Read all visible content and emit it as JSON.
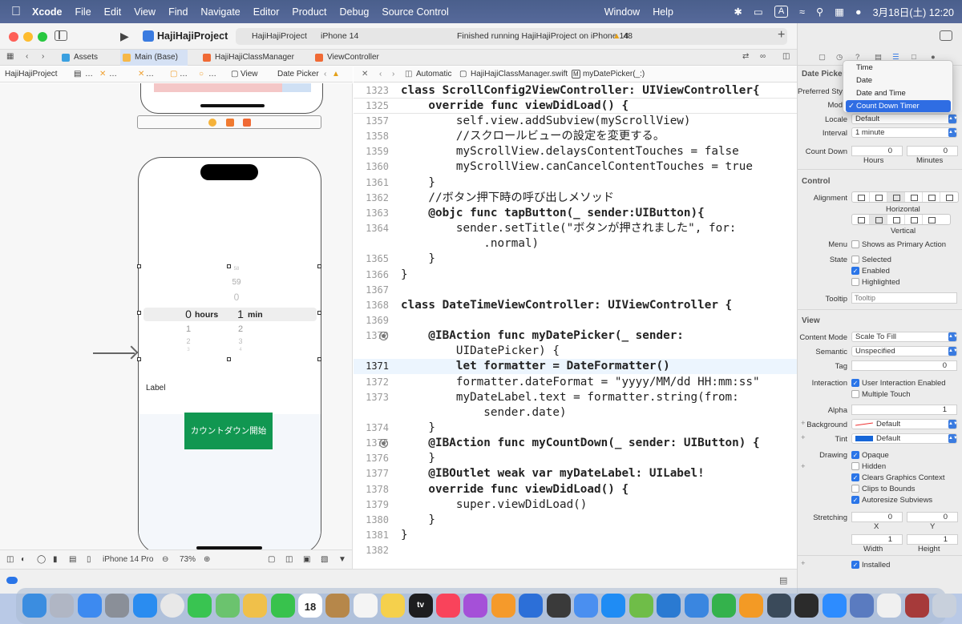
{
  "menubar": {
    "app_name": "Xcode",
    "items": [
      "File",
      "Edit",
      "View",
      "Find",
      "Navigate",
      "Editor",
      "Product",
      "Debug",
      "Source Control",
      "Window",
      "Help"
    ],
    "input_mode": "A",
    "datetime": "3月18日(土) 12:20"
  },
  "toolbar": {
    "project_name": "HajiHajiProject",
    "scheme": "HajiHajiProject",
    "destination": "iPhone 14",
    "status": "Finished running HajiHajiProject on iPhone 14",
    "warnings": "48"
  },
  "tabs": [
    {
      "label": "Assets",
      "icon": "assets-icon"
    },
    {
      "label": "Main (Base)",
      "icon": "storyboard-icon"
    },
    {
      "label": "HajiHajiClassManager",
      "icon": "swift-file-icon"
    },
    {
      "label": "ViewController",
      "icon": "swift-file-icon"
    }
  ],
  "left_jumpbar": [
    "HajiHajiProject",
    "…",
    "…",
    "…",
    "…",
    "View",
    "Date Picker"
  ],
  "right_jumpbar": [
    "Automatic",
    "HajiHajiClassManager.swift",
    "myDatePicker(_:)"
  ],
  "canvas": {
    "picker": {
      "above_small": "58",
      "above1": "59",
      "above2": "0",
      "hours_value": "0",
      "hours_label": "hours",
      "min_value": "1",
      "min_label": "min",
      "below_h1": "1",
      "below_h2": "2",
      "below_h3": "3",
      "below_m1": "2",
      "below_m2": "3",
      "below_m3": "4"
    },
    "label_text": "Label",
    "button_text": "カウントダウン開始"
  },
  "canvas_bottom": {
    "device": "iPhone 14 Pro",
    "zoom": "73%"
  },
  "code": {
    "sticky": [
      {
        "n": "1323",
        "t": "class ScrollConfig2ViewController: UIViewController{"
      },
      {
        "n": "1325",
        "t": "    override func viewDidLoad() {"
      }
    ],
    "lines": [
      {
        "n": "1357",
        "t": "        self.view.addSubview(myScrollView)"
      },
      {
        "n": "1358",
        "t": "        //スクロールビューの設定を変更する。"
      },
      {
        "n": "1359",
        "t": "        myScrollView.delaysContentTouches = false"
      },
      {
        "n": "1360",
        "t": "        myScrollView.canCancelContentTouches = true"
      },
      {
        "n": "1361",
        "t": "    }"
      },
      {
        "n": "1362",
        "t": "    //ボタン押下時の呼び出しメソッド"
      },
      {
        "n": "1363",
        "t": "    @objc func tapButton(_ sender:UIButton){"
      },
      {
        "n": "1364",
        "t": "        sender.setTitle(\"ボタンが押されました\", for:"
      },
      {
        "n": "",
        "t": "            .normal)"
      },
      {
        "n": "1365",
        "t": "    }"
      },
      {
        "n": "1366",
        "t": "}"
      },
      {
        "n": "1367",
        "t": ""
      },
      {
        "n": "1368",
        "t": "class DateTimeViewController: UIViewController {"
      },
      {
        "n": "1369",
        "t": ""
      },
      {
        "n": "1370",
        "t": "    @IBAction func myDatePicker(_ sender:"
      },
      {
        "n": "",
        "t": "        UIDatePicker) {"
      },
      {
        "n": "1371",
        "t": "        let formatter = DateFormatter()"
      },
      {
        "n": "1372",
        "t": "        formatter.dateFormat = \"yyyy/MM/dd HH:mm:ss\""
      },
      {
        "n": "1373",
        "t": "        myDateLabel.text = formatter.string(from:"
      },
      {
        "n": "",
        "t": "            sender.date)"
      },
      {
        "n": "1374",
        "t": "    }"
      },
      {
        "n": "1375",
        "t": "    @IBAction func myCountDown(_ sender: UIButton) {"
      },
      {
        "n": "1376",
        "t": "    }"
      },
      {
        "n": "1377",
        "t": "    @IBOutlet weak var myDateLabel: UILabel!"
      },
      {
        "n": "1378",
        "t": "    override func viewDidLoad() {"
      },
      {
        "n": "1379",
        "t": "        super.viewDidLoad()"
      },
      {
        "n": "1380",
        "t": "    }"
      },
      {
        "n": "1381",
        "t": "}"
      },
      {
        "n": "1382",
        "t": ""
      }
    ]
  },
  "inspector": {
    "section_date_picker": "Date Picker",
    "preferred_style_label": "Preferred Sty",
    "mode_label": "Mod",
    "locale_label": "Locale",
    "locale_value": "Default",
    "interval_label": "Interval",
    "interval_value": "1 minute",
    "countdown_label": "Count Down",
    "hours_value": "0",
    "minutes_value": "0",
    "hours_caption": "Hours",
    "minutes_caption": "Minutes",
    "section_control": "Control",
    "alignment_label": "Alignment",
    "horizontal_caption": "Horizontal",
    "vertical_caption": "Vertical",
    "menu_label": "Menu",
    "menu_option": "Shows as Primary Action",
    "state_label": "State",
    "state_selected": "Selected",
    "state_enabled": "Enabled",
    "state_highlighted": "Highlighted",
    "tooltip_label": "Tooltip",
    "tooltip_placeholder": "Tooltip",
    "section_view": "View",
    "content_mode_label": "Content Mode",
    "content_mode_value": "Scale To Fill",
    "semantic_label": "Semantic",
    "semantic_value": "Unspecified",
    "tag_label": "Tag",
    "tag_value": "0",
    "interaction_label": "Interaction",
    "interaction_user": "User Interaction Enabled",
    "interaction_multi": "Multiple Touch",
    "alpha_label": "Alpha",
    "alpha_value": "1",
    "background_label": "Background",
    "background_value": "Default",
    "tint_label": "Tint",
    "tint_value": "Default",
    "drawing_label": "Drawing",
    "drawing_opaque": "Opaque",
    "drawing_hidden": "Hidden",
    "drawing_clears": "Clears Graphics Context",
    "drawing_clips": "Clips to Bounds",
    "drawing_autoresize": "Autoresize Subviews",
    "stretching_label": "Stretching",
    "stretch_x_value": "0",
    "stretch_y_value": "0",
    "stretch_x_caption": "X",
    "stretch_y_caption": "Y",
    "stretch_w_value": "1",
    "stretch_h_value": "1",
    "stretch_w_caption": "Width",
    "stretch_h_caption": "Height",
    "installed": "Installed"
  },
  "mode_menu": {
    "items": [
      "Time",
      "Date",
      "Date and Time",
      "Count Down Timer"
    ],
    "selected": "Count Down Timer"
  },
  "dock": {
    "calendar_day": "18",
    "tv_label": "tv",
    "colors": {
      "finder": "#3b8de0",
      "launchpad": "#b0b6c4",
      "mail": "#3d8af0",
      "settings": "#8a8f98",
      "safari": "#2a8cf0",
      "chrome": "#e8e8e8",
      "messages": "#39c451",
      "maps": "#6bc36e",
      "photos": "#f0c04a",
      "facetime": "#38c24d",
      "calendar": "#ffffff",
      "notes_brown": "#b6874a",
      "reminders": "#f4f4f4",
      "notes": "#f5d04c",
      "appletv": "#1d1d1f",
      "music": "#f9435b",
      "podcasts": "#a550d8",
      "books": "#f59a2b",
      "xcode": "#2c6fd8",
      "instruments": "#3a3a3a",
      "simulator": "#4a8ff0",
      "appstore": "#1f8cf4",
      "script": "#6fbd48",
      "vscode": "#2a7ad2",
      "keynote": "#3a86e0",
      "numbers": "#34b24c",
      "pages": "#f39a25",
      "debug": "#3a4a5a",
      "terminal": "#2b2b2b",
      "zoom": "#2d8cff",
      "preview": "#5a7bc0",
      "textedit": "#f0f0f0",
      "dictionary": "#a63a3a",
      "trash": "#c8d0dc"
    }
  }
}
